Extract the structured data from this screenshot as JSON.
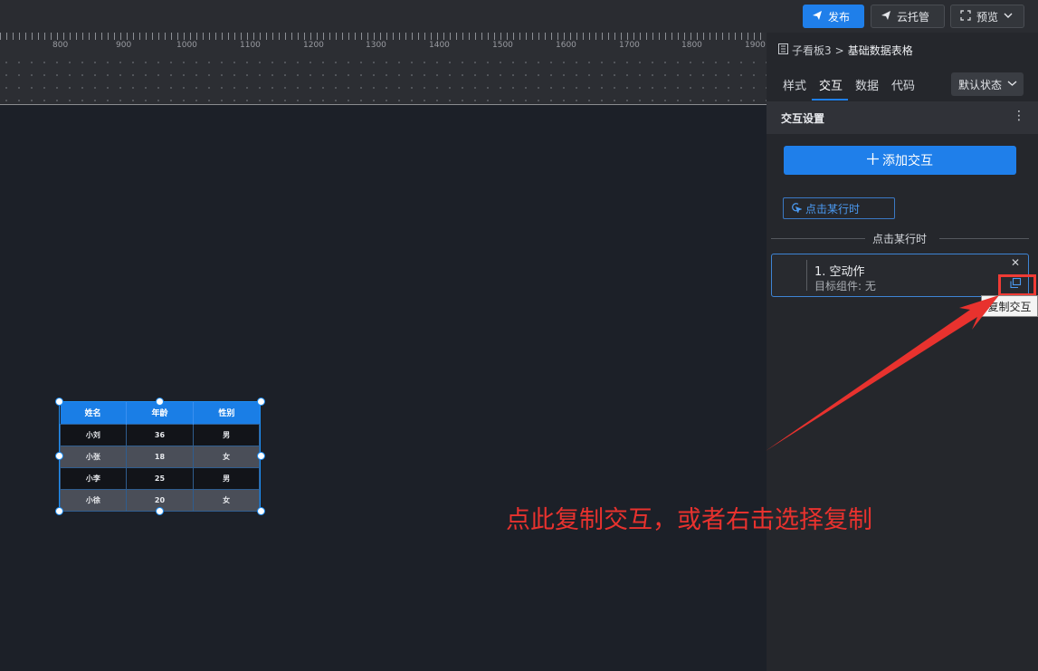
{
  "topbar": {
    "publish_label": "发布",
    "cloud_label": "云托管",
    "preview_label": "预览"
  },
  "ruler": {
    "labels": [
      "800",
      "900",
      "1000",
      "1100",
      "1200",
      "1300",
      "1400",
      "1500",
      "1600",
      "1700",
      "1800",
      "1900"
    ]
  },
  "table": {
    "headers": [
      "姓名",
      "年龄",
      "性别"
    ],
    "rows": [
      [
        "小刘",
        "36",
        "男"
      ],
      [
        "小张",
        "18",
        "女"
      ],
      [
        "小李",
        "25",
        "男"
      ],
      [
        "小徐",
        "20",
        "女"
      ]
    ]
  },
  "annotation": {
    "text": "点此复制交互，或者右击选择复制",
    "color": "#e8322e"
  },
  "panel": {
    "breadcrumb_parent": "子看板3",
    "breadcrumb_sep": ">",
    "breadcrumb_current": "基础数据表格",
    "tabs": [
      "样式",
      "交互",
      "数据",
      "代码"
    ],
    "active_tab": "交互",
    "state_select": "默认状态",
    "section_title": "交互设置",
    "add_button": "添加交互",
    "event_tag": "点击某行时",
    "divider_text": "点击某行时",
    "action_title": "1. 空动作",
    "action_sub": "目标组件: 无",
    "tooltip": "复制交互"
  },
  "colors": {
    "accent": "#1f7fea",
    "annotation_red": "#f03b35"
  }
}
